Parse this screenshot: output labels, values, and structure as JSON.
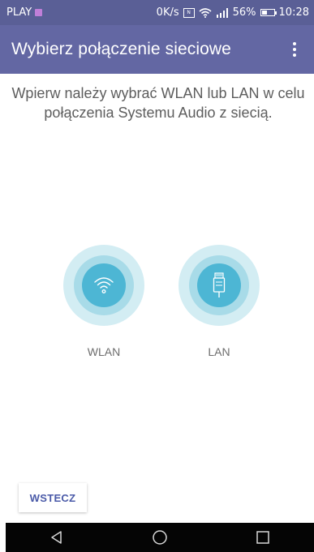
{
  "status_bar": {
    "carrier": "PLAY",
    "speed": "0K/s",
    "battery": "56%",
    "battery_level": 0.56,
    "time": "10:28",
    "icons": [
      "carrier-badge-icon",
      "nfc-icon",
      "wifi-icon",
      "signal-icon",
      "battery-icon"
    ]
  },
  "app_bar": {
    "title": "Wybierz połączenie sieciowe",
    "menu_icon": "more-vert-icon"
  },
  "main": {
    "instructions": "Wpierw należy wybrać WLAN lub LAN w celu połączenia Systemu Audio z siecią.",
    "options": [
      {
        "label": "WLAN",
        "icon": "wifi-icon"
      },
      {
        "label": "LAN",
        "icon": "ethernet-plug-icon"
      }
    ]
  },
  "footer": {
    "back_label": "WSTECZ"
  },
  "nav_bar": {
    "buttons": [
      "back-triangle-icon",
      "home-circle-icon",
      "recents-square-icon"
    ]
  },
  "colors": {
    "status_bar": "#5a5f96",
    "app_bar": "#6367a3",
    "ring_outer": "#d3edf3",
    "ring_middle": "#a8dbe8",
    "ring_inner": "#4db6d4",
    "accent_text": "#4a5aa8"
  }
}
